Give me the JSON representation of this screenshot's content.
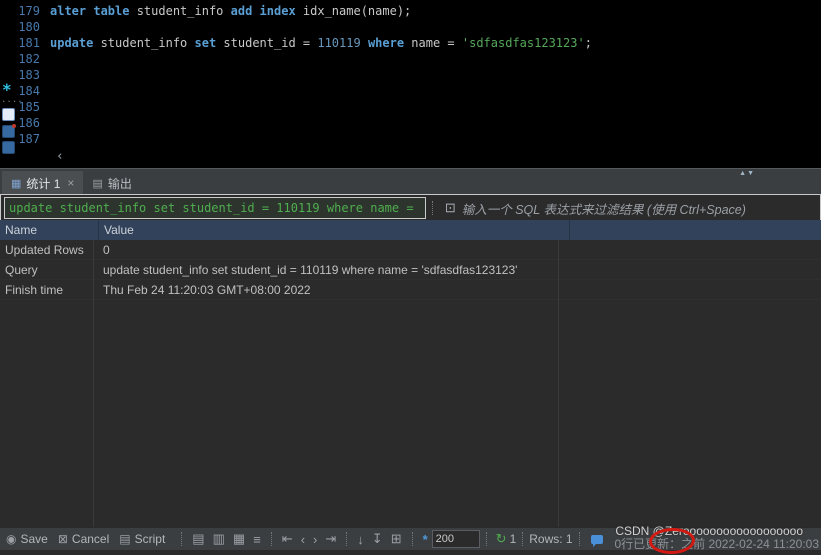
{
  "icons": {
    "star-icon": "*",
    "more-dots-icon": "....",
    "scroll-left-icon": "‹",
    "table-icon": "▦",
    "output-icon": "▤",
    "close-icon": "×",
    "splitter-arrows-icon": "▲▼",
    "expand-filter-icon": "⊡",
    "save-icon": "◉",
    "cancel-icon": "⊠",
    "script-icon": "▤",
    "panel-filter-icon": "▤",
    "panel-calc-icon": "▥",
    "panel-grid-icon": "▦",
    "panel-meta-icon": "≡",
    "first-row-icon": "⇤",
    "prev-row-icon": "‹",
    "next-row-icon": "›",
    "last-row-icon": "⇥",
    "fetch-next-icon": "↓",
    "fetch-all-icon": "↧",
    "export-icon": "⊞",
    "fetch-size-icon": "*",
    "refresh-icon": "↻"
  },
  "editor": {
    "lines": [
      {
        "n": "179",
        "code": [
          [
            "kw",
            "alter table"
          ],
          [
            "pl",
            " student_info "
          ],
          [
            "kw",
            "add index"
          ],
          [
            "pl",
            " idx_name(name);"
          ]
        ]
      },
      {
        "n": "180",
        "code": []
      },
      {
        "n": "181",
        "code": [
          [
            "kw",
            "update"
          ],
          [
            "pl",
            " student_info "
          ],
          [
            "kw",
            "set"
          ],
          [
            "pl",
            " student_id = "
          ],
          [
            "num",
            "110119"
          ],
          [
            "pl",
            " "
          ],
          [
            "kw",
            "where"
          ],
          [
            "pl",
            " name = "
          ],
          [
            "str",
            "'sdfasdfas123123'"
          ],
          [
            "pl",
            ";"
          ]
        ]
      },
      {
        "n": "182",
        "code": []
      },
      {
        "n": "183",
        "code": []
      },
      {
        "n": "184",
        "code": []
      },
      {
        "n": "185",
        "code": []
      },
      {
        "n": "186",
        "code": []
      },
      {
        "n": "187",
        "code": []
      }
    ]
  },
  "tabs": [
    {
      "label": "统计 1",
      "active": true
    },
    {
      "label": "输出",
      "active": false
    }
  ],
  "filter": {
    "value": "update student_info set student_id = 110119 where name = ",
    "hint": "输入一个 SQL 表达式来过滤结果 (使用 Ctrl+Space)"
  },
  "table": {
    "columns": [
      "Name",
      "Value"
    ],
    "rows": [
      [
        "Updated Rows",
        "0"
      ],
      [
        "Query",
        "update student_info set student_id = 110119 where name = 'sdfasdfas123123'"
      ],
      [
        "Finish time",
        "Thu Feb 24 11:20:03 GMT+08:00 2022"
      ]
    ]
  },
  "statusbar": {
    "save_label": "Save",
    "cancel_label": "Cancel",
    "script_label": "Script",
    "fetch_size": "200",
    "refresh_count": "1",
    "rows_label": "Rows: 1",
    "status_text": "0行已更新：之前 2022-02-24 11:20:03",
    "watermark": "CSDN @Zeroooooooooooooooooo"
  }
}
